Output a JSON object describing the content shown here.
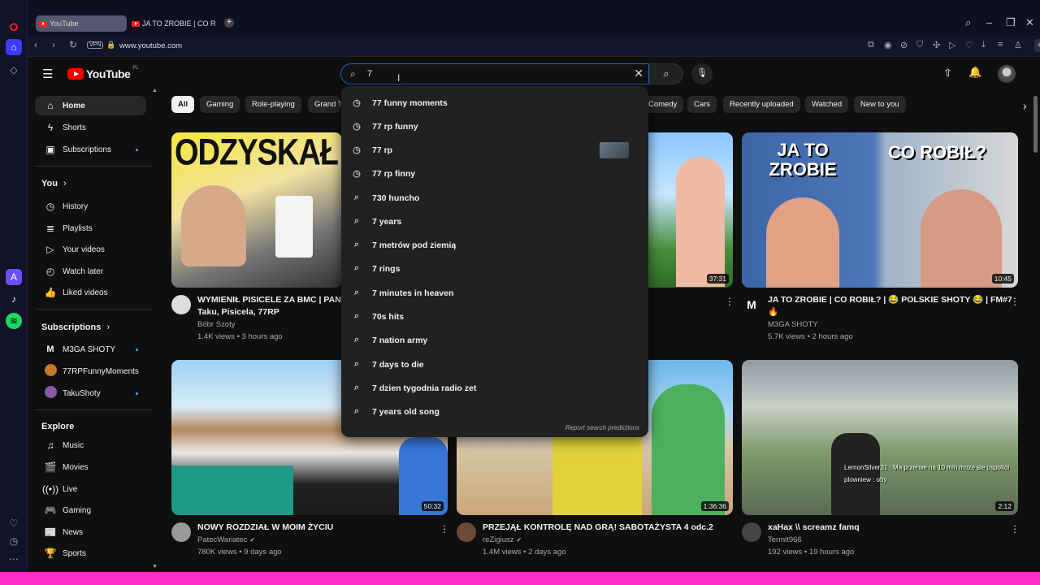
{
  "browser": {
    "tabs": [
      {
        "label": "YouTube"
      },
      {
        "label": "JA TO ZROBIE | CO ROBIŁ?"
      }
    ],
    "address": "www.youtube.com",
    "vpn_label": "VPN"
  },
  "masthead": {
    "logo_text": "YouTube",
    "region": "PL",
    "search_value": "7"
  },
  "guide": {
    "main": [
      "Home",
      "Shorts",
      "Subscriptions"
    ],
    "you_title": "You",
    "you": [
      "History",
      "Playlists",
      "Your videos",
      "Watch later",
      "Liked videos"
    ],
    "subs_title": "Subscriptions",
    "subs": [
      "M3GA SHOTY",
      "77RPFunnyMoments",
      "TakuShoty"
    ],
    "explore_title": "Explore",
    "explore": [
      "Music",
      "Movies",
      "Live",
      "Gaming",
      "News",
      "Sports"
    ]
  },
  "chips": [
    "All",
    "Gaming",
    "Role-playing",
    "Grand T",
    "Comedy",
    "Cars",
    "Recently uploaded",
    "Watched",
    "New to you"
  ],
  "suggestions": [
    "77 funny moments",
    "77 rp funny",
    "77 rp",
    "77 rp finny",
    "730 huncho",
    "7 years",
    "7 metrów pod ziemią",
    "7 rings",
    "7 minutes in heaven",
    "70s hits",
    "7 nation army",
    "7 days to die",
    "7 dzien tygodnia radio zet",
    "7 years old song"
  ],
  "report_label": "Report search predictions",
  "videos": [
    {
      "title1": "WYMIENIŁ PISICELE ZA BMC  | PAN I",
      "title2": "Taku, Pisicela, 77RP",
      "channel": "Bóbr Szoty",
      "meta": "1.4K views • 3 hours ago",
      "thumb_text": "ODZYSKAŁ",
      "duration": ""
    },
    {
      "title1": "",
      "title2": "",
      "channel": "",
      "meta": "",
      "thumb_text": "",
      "duration": "37:31"
    },
    {
      "title1": "JA TO ZROBIE | CO ROBIŁ? | 😂 POLSKIE SHOTY 😂 | FM#765",
      "title2": "🔥",
      "channel": "M3GA SHOTY",
      "meta": "5.7K views • 2 hours ago",
      "thumb_text": "JA TO ZROBIE",
      "thumb_text2": "CO ROBIŁ?",
      "duration": "10:45"
    },
    {
      "title1": "NOWY ROZDZIAŁ W MOIM ŻYCIU",
      "title2": "",
      "channel": "PatecWariatec",
      "meta": "780K views • 9 days ago",
      "thumb_text": "",
      "duration": "50:32"
    },
    {
      "title1": "PRZEJĄŁ KONTROLĘ NAD GRĄ! SABOTAŻYSTA 4 odc.2",
      "title2": "",
      "channel": "reZigiusz",
      "meta": "1.4M views • 2 days ago",
      "thumb_text": "",
      "duration": "1:36:36"
    },
    {
      "title1": "хаНах \\\\ screamz famq",
      "title2": "",
      "channel": "Termit966",
      "meta": "192 views • 19 hours ago",
      "thumb_text": "",
      "duration": "2:12",
      "chat1": "LemonSilver31 : Ma przerwe na 10 min moze sie uspokoi",
      "chat2": "plowniew : oby"
    }
  ]
}
